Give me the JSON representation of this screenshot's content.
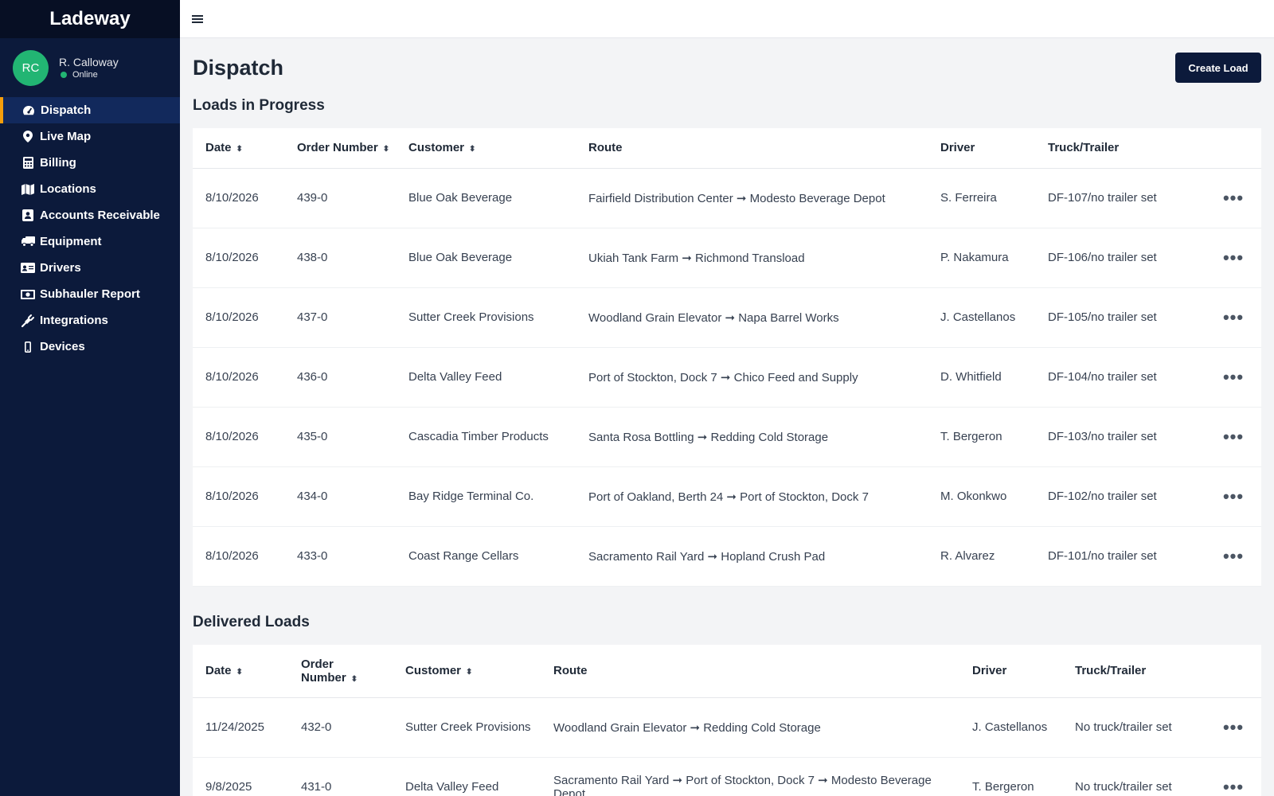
{
  "app": {
    "brand": "Ladeway"
  },
  "user": {
    "initials": "RC",
    "name": "R. Calloway",
    "status": "Online"
  },
  "colors": {
    "sidebar": "#0c1a3b",
    "accent": "#f59e0b",
    "avatar": "#22b573"
  },
  "nav": [
    {
      "label": "Dispatch",
      "icon": "dashboard-icon",
      "active": true
    },
    {
      "label": "Live Map",
      "icon": "map-pin-icon"
    },
    {
      "label": "Billing",
      "icon": "calculator-icon"
    },
    {
      "label": "Locations",
      "icon": "map-icon"
    },
    {
      "label": "Accounts Receivable",
      "icon": "address-book-icon"
    },
    {
      "label": "Equipment",
      "icon": "truck-icon"
    },
    {
      "label": "Drivers",
      "icon": "id-card-icon"
    },
    {
      "label": "Subhauler Report",
      "icon": "money-bill-icon"
    },
    {
      "label": "Integrations",
      "icon": "plug-icon"
    },
    {
      "label": "Devices",
      "icon": "mobile-icon"
    }
  ],
  "page": {
    "title": "Dispatch",
    "create_button": "Create Load"
  },
  "in_progress": {
    "title": "Loads in Progress",
    "columns": [
      "Date",
      "Order Number",
      "Customer",
      "Route",
      "Driver",
      "Truck/Trailer"
    ],
    "rows": [
      {
        "date": "8/10/2026",
        "order": "439-0",
        "customer": "Blue Oak Beverage",
        "route": "Fairfield Distribution Center ➞ Modesto Beverage Depot",
        "driver": "S. Ferreira",
        "truck": "DF-107/no trailer set"
      },
      {
        "date": "8/10/2026",
        "order": "438-0",
        "customer": "Blue Oak Beverage",
        "route": "Ukiah Tank Farm ➞ Richmond Transload",
        "driver": "P. Nakamura",
        "truck": "DF-106/no trailer set"
      },
      {
        "date": "8/10/2026",
        "order": "437-0",
        "customer": "Sutter Creek Provisions",
        "route": "Woodland Grain Elevator ➞ Napa Barrel Works",
        "driver": "J. Castellanos",
        "truck": "DF-105/no trailer set"
      },
      {
        "date": "8/10/2026",
        "order": "436-0",
        "customer": "Delta Valley Feed",
        "route": "Port of Stockton, Dock 7 ➞ Chico Feed and Supply",
        "driver": "D. Whitfield",
        "truck": "DF-104/no trailer set"
      },
      {
        "date": "8/10/2026",
        "order": "435-0",
        "customer": "Cascadia Timber Products",
        "route": "Santa Rosa Bottling ➞ Redding Cold Storage",
        "driver": "T. Bergeron",
        "truck": "DF-103/no trailer set"
      },
      {
        "date": "8/10/2026",
        "order": "434-0",
        "customer": "Bay Ridge Terminal Co.",
        "route": "Port of Oakland, Berth 24 ➞ Port of Stockton, Dock 7",
        "driver": "M. Okonkwo",
        "truck": "DF-102/no trailer set"
      },
      {
        "date": "8/10/2026",
        "order": "433-0",
        "customer": "Coast Range Cellars",
        "route": "Sacramento Rail Yard ➞ Hopland Crush Pad",
        "driver": "R. Alvarez",
        "truck": "DF-101/no trailer set"
      }
    ]
  },
  "delivered": {
    "title": "Delivered Loads",
    "columns": [
      "Date",
      "Order Number",
      "Customer",
      "Route",
      "Driver",
      "Truck/Trailer"
    ],
    "rows": [
      {
        "date": "11/24/2025",
        "order": "432-0",
        "customer": "Sutter Creek Provisions",
        "route": "Woodland Grain Elevator ➞ Redding Cold Storage",
        "driver": "J. Castellanos",
        "truck": "No truck/trailer set"
      },
      {
        "date": "9/8/2025",
        "order": "431-0",
        "customer": "Delta Valley Feed",
        "route": "Sacramento Rail Yard ➞ Port of Stockton, Dock 7 ➞ Modesto Beverage Depot",
        "driver": "T. Bergeron",
        "truck": "No truck/trailer set"
      }
    ]
  }
}
